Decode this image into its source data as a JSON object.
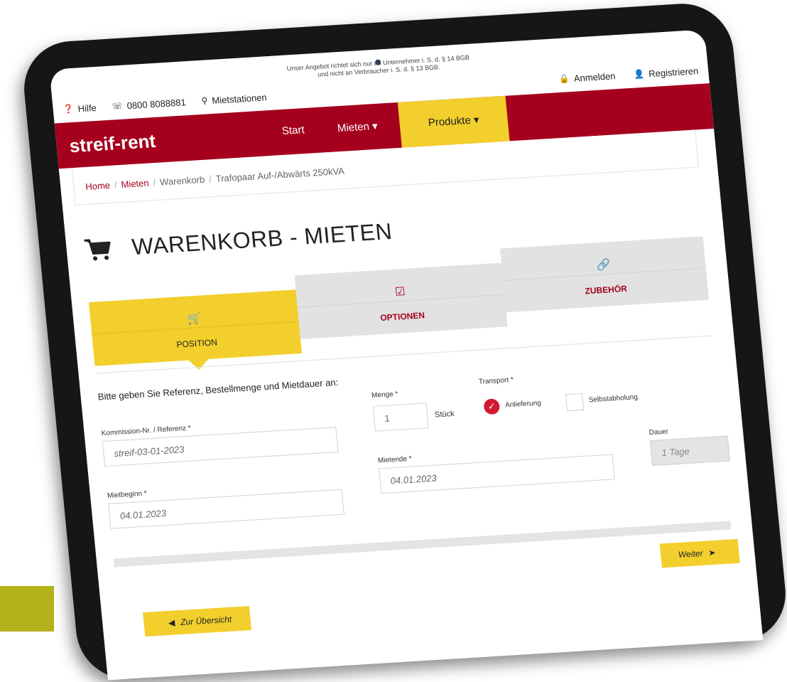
{
  "disclaimer": {
    "line1": "Unser Angebot richtet sich nur an Unternehmer i. S. d. § 14 BGB",
    "line2": "und nicht an Verbraucher i. S. d. § 13 BGB."
  },
  "topbar": {
    "help": "Hilfe",
    "phone": "0800 8088881",
    "stations": "Mietstationen",
    "login": "Anmelden",
    "register": "Registrieren"
  },
  "nav": {
    "brand": "streif-rent",
    "start": "Start",
    "mieten": "Mieten ▾",
    "produkte": "Produkte ▾"
  },
  "breadcrumb": {
    "home": "Home",
    "mieten": "Mieten",
    "warenkorb": "Warenkorb",
    "current": "Trafopaar Auf-/Abwärts 250kVA"
  },
  "page": {
    "title": "WARENKORB - MIETEN"
  },
  "steps": [
    {
      "label": "POSITION",
      "icon": "cart-icon"
    },
    {
      "label": "OPTIONEN",
      "icon": "checkbox-icon"
    },
    {
      "label": "ZUBEHÖR",
      "icon": "link-icon"
    }
  ],
  "form": {
    "instruction": "Bitte geben Sie Referenz, Bestellmenge und Mietdauer an:",
    "reference_label": "Kommission-Nr. / Referenz *",
    "reference_placeholder": "streif-03-01-2023",
    "menge_label": "Menge *",
    "menge_value": "1",
    "menge_unit": "Stück",
    "transport_label": "Transport *",
    "transport_delivery": "Anlieferung",
    "transport_pickup": "Selbstabholung",
    "start_label": "Mietbeginn *",
    "start_value": "04.01.2023",
    "end_label": "Mietende *",
    "end_value": "04.01.2023",
    "duration_label": "Dauer",
    "duration_value": "1 Tage"
  },
  "buttons": {
    "next": "Weiter",
    "overview": "Zur Übersicht"
  },
  "colors": {
    "brand_red": "#a5001e",
    "accent_yellow": "#f2cf2c",
    "check_red": "#d11a32",
    "corner_accent": "#b3b21c"
  }
}
